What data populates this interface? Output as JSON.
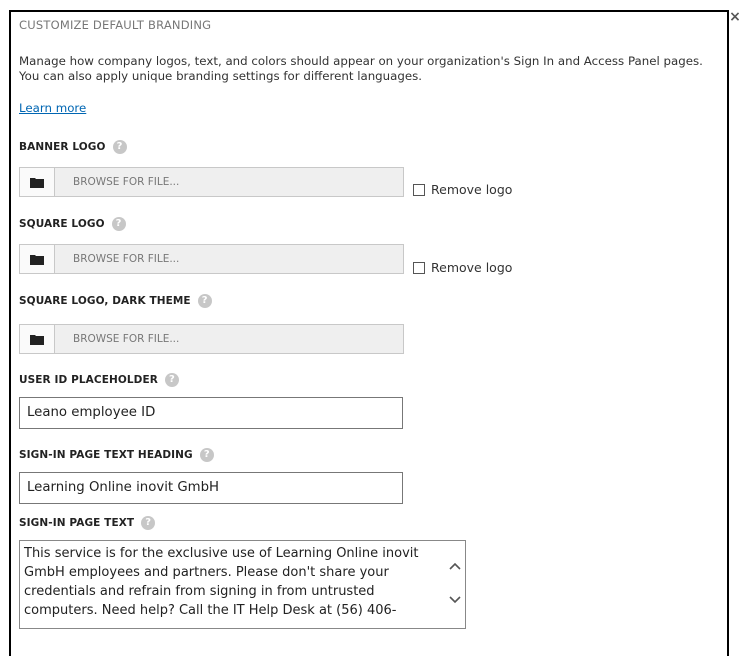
{
  "dialog": {
    "title": "CUSTOMIZE DEFAULT BRANDING",
    "close_glyph": "×",
    "description": "Manage how company logos, text, and colors should appear on your organization's Sign In and Access Panel pages. You can also apply unique branding settings for different languages.",
    "learn_more": "Learn more"
  },
  "help_glyph": "?",
  "banner_logo": {
    "label": "BANNER LOGO",
    "browse_text": "BROWSE FOR FILE...",
    "remove_label": "Remove logo",
    "remove_checked": false
  },
  "square_logo": {
    "label": "SQUARE LOGO",
    "browse_text": "BROWSE FOR FILE...",
    "remove_label": "Remove logo",
    "remove_checked": false
  },
  "square_logo_dark": {
    "label": "SQUARE LOGO, DARK THEME",
    "browse_text": "BROWSE FOR FILE..."
  },
  "user_id_placeholder": {
    "label": "USER ID PLACEHOLDER",
    "value": "Leano employee ID"
  },
  "signin_heading": {
    "label": "SIGN-IN PAGE TEXT HEADING",
    "value": "Learning Online inovit GmbH"
  },
  "signin_text": {
    "label": "SIGN-IN PAGE TEXT",
    "value": "This service is for the exclusive use of Learning Online inovit GmbH employees and partners. Please don't share your credentials and refrain from signing in from untrusted computers. Need help? Call the IT Help Desk at (56) 406-"
  },
  "icons": {
    "folder": "folder-icon",
    "help": "help-icon",
    "close": "close-icon",
    "scroll_up": "chevron-up-icon",
    "scroll_down": "chevron-down-icon"
  },
  "colors": {
    "link": "#0066b3",
    "help_badge": "#c7c7c7",
    "browse_bg": "#efefef"
  }
}
